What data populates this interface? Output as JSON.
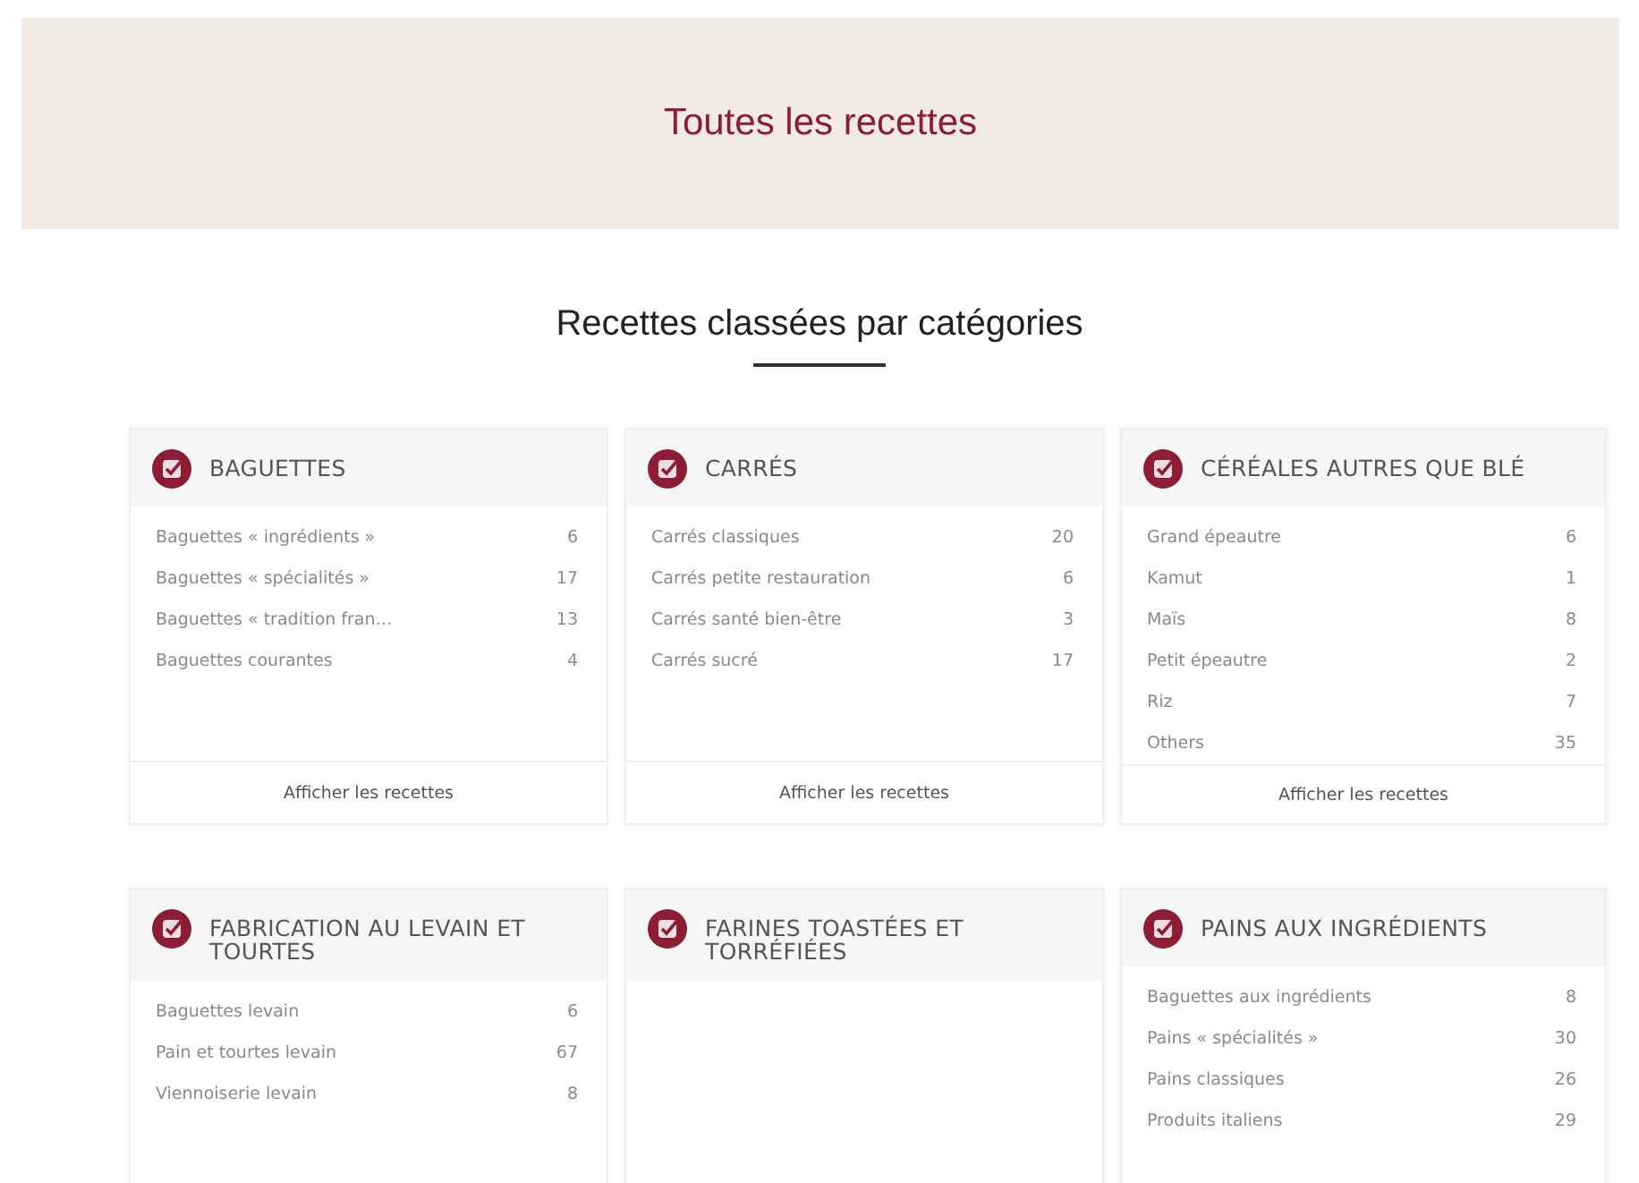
{
  "banner": {
    "title": "Toutes les recettes"
  },
  "section": {
    "heading": "Recettes classées par catégories"
  },
  "categories": [
    {
      "name": "BAGUETTES",
      "items": [
        {
          "label": "Baguettes « ingrédients »",
          "count": "6"
        },
        {
          "label": "Baguettes « spécialités »",
          "count": "17"
        },
        {
          "label": "Baguettes « tradition fran…",
          "count": "13"
        },
        {
          "label": "Baguettes courantes",
          "count": "4"
        }
      ],
      "link": "Afficher les recettes"
    },
    {
      "name": "CARRÉS",
      "items": [
        {
          "label": "Carrés classiques",
          "count": "20"
        },
        {
          "label": "Carrés petite restauration",
          "count": "6"
        },
        {
          "label": "Carrés santé bien-être",
          "count": "3"
        },
        {
          "label": "Carrés sucré",
          "count": "17"
        }
      ],
      "link": "Afficher les recettes"
    },
    {
      "name": "CÉRÉALES AUTRES QUE BLÉ",
      "items": [
        {
          "label": "Grand épeautre",
          "count": "6"
        },
        {
          "label": "Kamut",
          "count": "1"
        },
        {
          "label": "Maïs",
          "count": "8"
        },
        {
          "label": "Petit épeautre",
          "count": "2"
        },
        {
          "label": "Riz",
          "count": "7"
        },
        {
          "label": "Others",
          "count": "35"
        }
      ],
      "link": "Afficher les recettes"
    },
    {
      "name": "FABRICATION AU LEVAIN ET TOURTES",
      "items": [
        {
          "label": "Baguettes levain",
          "count": "6"
        },
        {
          "label": "Pain et tourtes levain",
          "count": "67"
        },
        {
          "label": "Viennoiserie levain",
          "count": "8"
        }
      ]
    },
    {
      "name": "FARINES TOASTÉES ET TORRÉFIÉES"
    },
    {
      "name": "PAINS AUX INGRÉDIENTS",
      "items": [
        {
          "label": "Baguettes aux ingrédients",
          "count": "8"
        },
        {
          "label": "Pains « spécialités »",
          "count": "30"
        },
        {
          "label": "Pains classiques",
          "count": "26"
        },
        {
          "label": "Produits italiens",
          "count": "29"
        }
      ]
    }
  ]
}
